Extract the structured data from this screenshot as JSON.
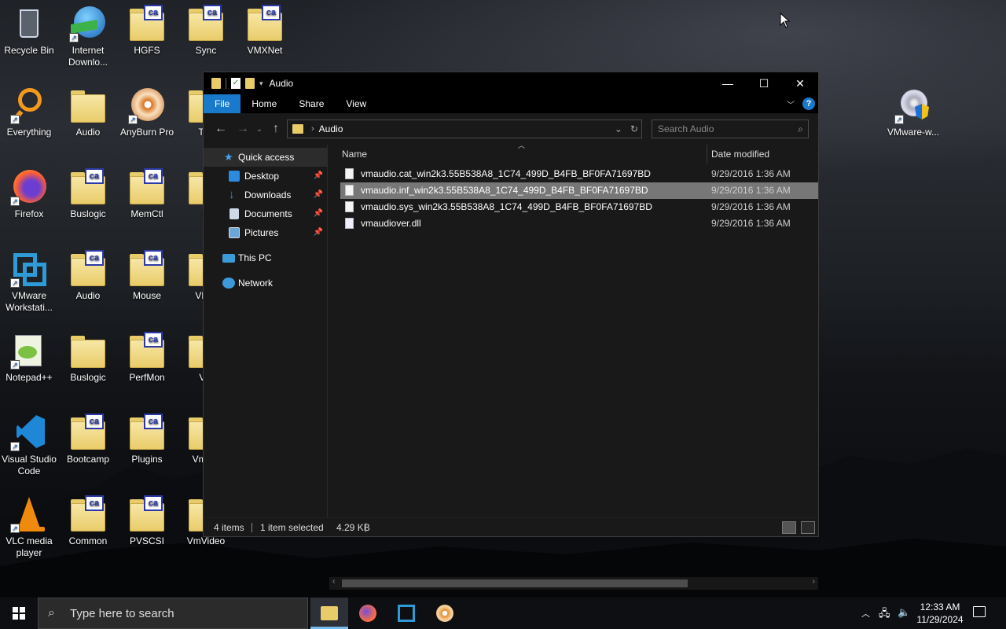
{
  "desktop": {
    "icons": [
      {
        "label": "Recycle Bin",
        "kind": "recycle-bin"
      },
      {
        "label": "Internet Downlo...",
        "kind": "idm"
      },
      {
        "label": "HGFS",
        "kind": "folder-ca"
      },
      {
        "label": "Sync",
        "kind": "folder-ca"
      },
      {
        "label": "VMXNet",
        "kind": "folder-ca"
      },
      {
        "label": "Everything",
        "kind": "everything"
      },
      {
        "label": "Audio",
        "kind": "folder"
      },
      {
        "label": "AnyBurn Pro",
        "kind": "anyburn"
      },
      {
        "label": "Too",
        "kind": "folder"
      },
      {
        "label": "Firefox",
        "kind": "firefox"
      },
      {
        "label": "Buslogic",
        "kind": "folder-ca"
      },
      {
        "label": "MemCtl",
        "kind": "folder-ca"
      },
      {
        "label": "U",
        "kind": "folder"
      },
      {
        "label": "VMware Workstati...",
        "kind": "vmware"
      },
      {
        "label": "Audio",
        "kind": "folder-ca"
      },
      {
        "label": "Mouse",
        "kind": "folder-ca"
      },
      {
        "label": "VFile",
        "kind": "folder"
      },
      {
        "label": "Notepad++",
        "kind": "notepadpp"
      },
      {
        "label": "Buslogic",
        "kind": "folder"
      },
      {
        "label": "PerfMon",
        "kind": "folder-ca"
      },
      {
        "label": "VG",
        "kind": "folder"
      },
      {
        "label": "Visual Studio Code",
        "kind": "vscode"
      },
      {
        "label": "Bootcamp",
        "kind": "folder-ca"
      },
      {
        "label": "Plugins",
        "kind": "folder-ca"
      },
      {
        "label": "VmciS",
        "kind": "folder"
      },
      {
        "label": "VLC media player",
        "kind": "vlc"
      },
      {
        "label": "Common",
        "kind": "folder-ca"
      },
      {
        "label": "PVSCSI",
        "kind": "folder-ca"
      },
      {
        "label": "VmVideo",
        "kind": "folder"
      },
      {
        "label": "VMware-w...",
        "kind": "vmware-installer"
      }
    ],
    "badge_text": "ca"
  },
  "explorer": {
    "title": "Audio",
    "ribbon_tabs": [
      "File",
      "Home",
      "Share",
      "View"
    ],
    "address_path": "Audio",
    "search_placeholder": "Search Audio",
    "nav_pane": {
      "quick_access": "Quick access",
      "pinned": [
        {
          "label": "Desktop",
          "icon": "desktop-icon"
        },
        {
          "label": "Downloads",
          "icon": "downloads-icon"
        },
        {
          "label": "Documents",
          "icon": "documents-icon"
        },
        {
          "label": "Pictures",
          "icon": "pictures-icon"
        }
      ],
      "this_pc": "This PC",
      "network": "Network"
    },
    "columns": {
      "name": "Name",
      "date": "Date modified"
    },
    "files": [
      {
        "name": "vmaudio.cat_win2k3.55B538A8_1C74_499D_B4FB_BF0FA71697BD",
        "date": "9/29/2016 1:36 AM",
        "selected": false,
        "type": "file"
      },
      {
        "name": "vmaudio.inf_win2k3.55B538A8_1C74_499D_B4FB_BF0FA71697BD",
        "date": "9/29/2016 1:36 AM",
        "selected": true,
        "type": "file"
      },
      {
        "name": "vmaudio.sys_win2k3.55B538A8_1C74_499D_B4FB_BF0FA71697BD",
        "date": "9/29/2016 1:36 AM",
        "selected": false,
        "type": "file"
      },
      {
        "name": "vmaudiover.dll",
        "date": "9/29/2016 1:36 AM",
        "selected": false,
        "type": "dll"
      }
    ],
    "status": {
      "items": "4 items",
      "selected": "1 item selected",
      "size": "4.29 KB"
    },
    "help_glyph": "?"
  },
  "taskbar": {
    "search_placeholder": "Type here to search",
    "apps": [
      "file-explorer-icon",
      "firefox-icon",
      "vmware-icon",
      "anyburn-icon"
    ],
    "time": "12:33 AM",
    "date": "11/29/2024"
  },
  "colors": {
    "accent": "#1979ca",
    "selected_row": "#777777",
    "folder": "#e9cc6a",
    "window_bg": "#191919"
  }
}
